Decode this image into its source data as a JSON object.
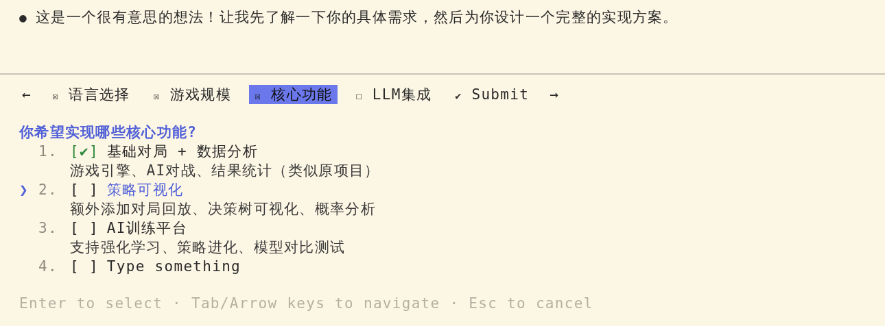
{
  "message": {
    "bullet": "●",
    "text": "这是一个很有意思的想法！让我先了解一下你的具体需求，然后为你设计一个完整的实现方案。"
  },
  "tabs": {
    "prev": "←",
    "next": "→",
    "items": [
      {
        "mark": "☒",
        "label": "语言选择",
        "selected": false
      },
      {
        "mark": "☒",
        "label": "游戏规模",
        "selected": false
      },
      {
        "mark": "☒",
        "label": "核心功能",
        "selected": true
      },
      {
        "mark": "☐",
        "label": "LLM集成",
        "selected": false
      },
      {
        "mark": "✔",
        "label": "Submit",
        "selected": false
      }
    ]
  },
  "question": "你希望实现哪些核心功能?",
  "cursor": "❯",
  "options": [
    {
      "number": "1.",
      "box": "[✔]",
      "checked": true,
      "selected": false,
      "label": "基础对局 + 数据分析",
      "description": "游戏引擎、AI对战、结果统计（类似原项目）"
    },
    {
      "number": "2.",
      "box": "[ ]",
      "checked": false,
      "selected": true,
      "label": "策略可视化",
      "description": "额外添加对局回放、决策树可视化、概率分析"
    },
    {
      "number": "3.",
      "box": "[ ]",
      "checked": false,
      "selected": false,
      "label": "AI训练平台",
      "description": "支持强化学习、策略进化、模型对比测试"
    },
    {
      "number": "4.",
      "box": "[ ]",
      "checked": false,
      "selected": false,
      "label": "Type something"
    }
  ],
  "hint": "Enter to select · Tab/Arrow keys to navigate · Esc to cancel"
}
